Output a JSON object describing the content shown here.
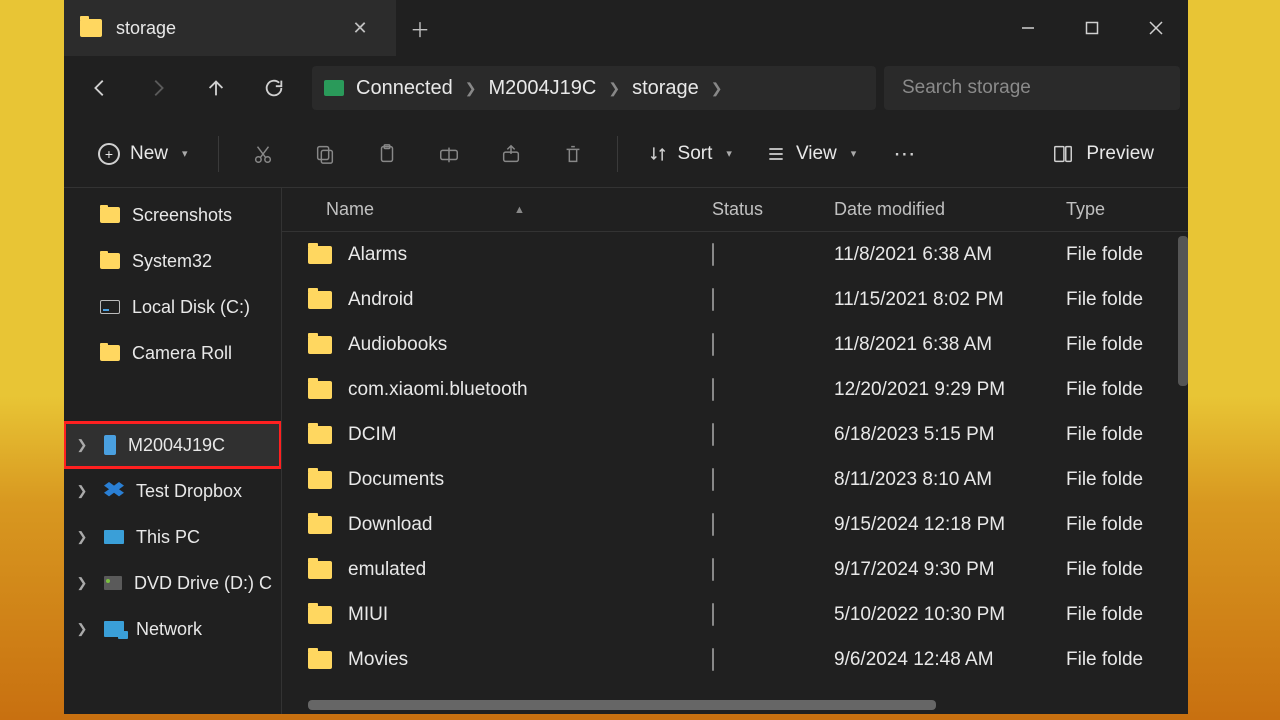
{
  "tab": {
    "title": "storage"
  },
  "breadcrumb": [
    "Connected",
    "M2004J19C",
    "storage"
  ],
  "search": {
    "placeholder": "Search storage"
  },
  "toolbar": {
    "new": "New",
    "sort": "Sort",
    "view": "View",
    "preview": "Preview"
  },
  "sidebar": {
    "quick": [
      "Screenshots",
      "System32",
      "Local Disk (C:)",
      "Camera Roll"
    ],
    "roots": [
      "M2004J19C",
      "Test Dropbox",
      "This PC",
      "DVD Drive (D:) C",
      "Network"
    ],
    "highlight_index": 0
  },
  "columns": {
    "name": "Name",
    "status": "Status",
    "date": "Date modified",
    "type": "Type"
  },
  "rows": [
    {
      "name": "Alarms",
      "date": "11/8/2021 6:38 AM",
      "type": "File folde"
    },
    {
      "name": "Android",
      "date": "11/15/2021 8:02 PM",
      "type": "File folde"
    },
    {
      "name": "Audiobooks",
      "date": "11/8/2021 6:38 AM",
      "type": "File folde"
    },
    {
      "name": "com.xiaomi.bluetooth",
      "date": "12/20/2021 9:29 PM",
      "type": "File folde"
    },
    {
      "name": "DCIM",
      "date": "6/18/2023 5:15 PM",
      "type": "File folde"
    },
    {
      "name": "Documents",
      "date": "8/11/2023 8:10 AM",
      "type": "File folde"
    },
    {
      "name": "Download",
      "date": "9/15/2024 12:18 PM",
      "type": "File folde"
    },
    {
      "name": "emulated",
      "date": "9/17/2024 9:30 PM",
      "type": "File folde"
    },
    {
      "name": "MIUI",
      "date": "5/10/2022 10:30 PM",
      "type": "File folde"
    },
    {
      "name": "Movies",
      "date": "9/6/2024 12:48 AM",
      "type": "File folde"
    }
  ]
}
